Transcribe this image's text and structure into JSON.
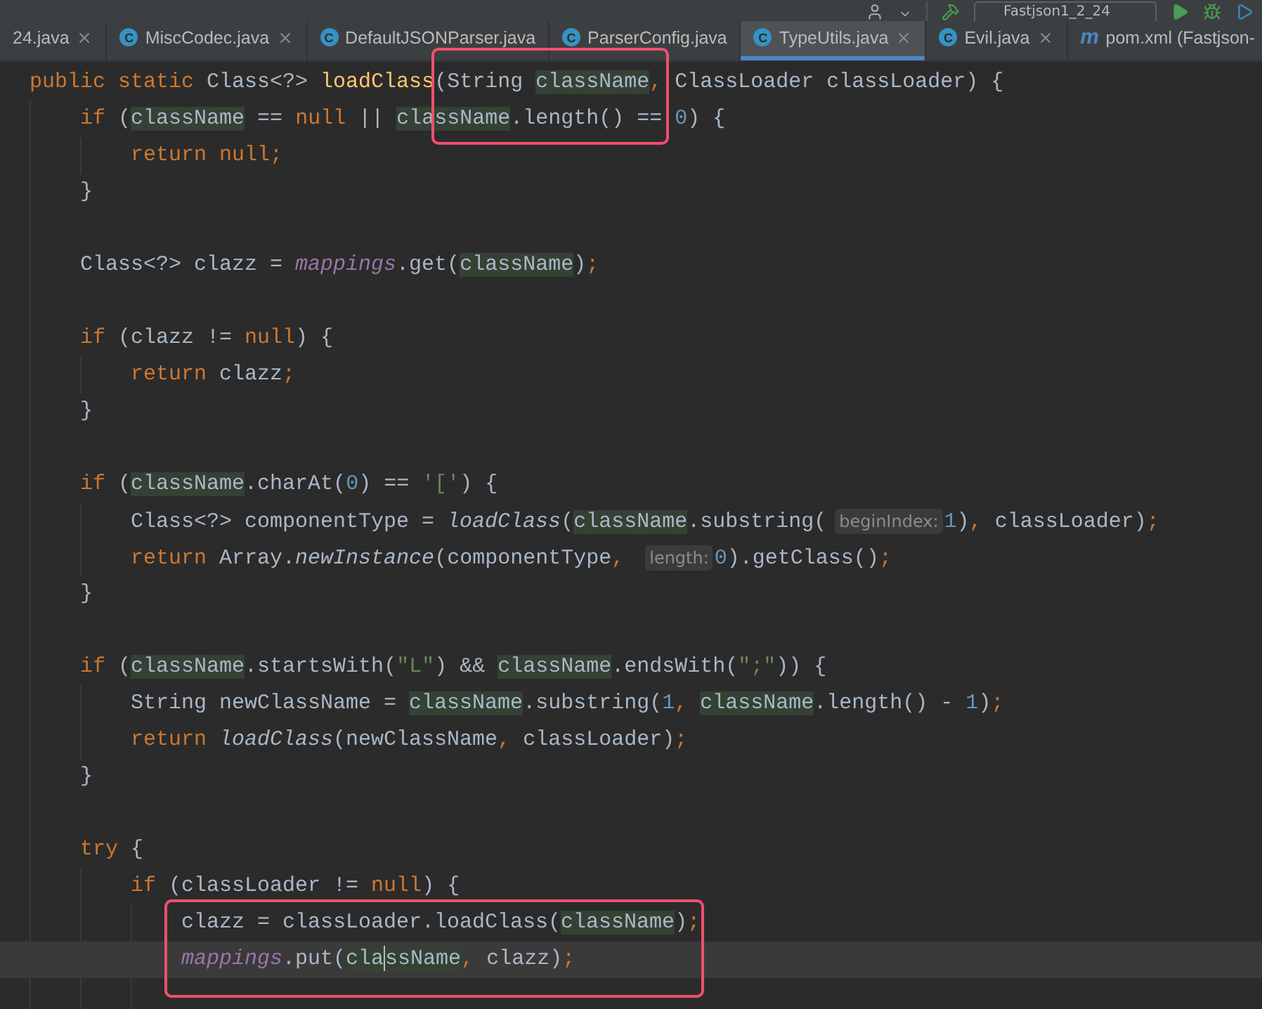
{
  "toolbar": {
    "run_config": "Fastjson1_2_24"
  },
  "tabs": [
    {
      "label": "24.java",
      "selected": false,
      "closable": true
    },
    {
      "label": "MiscCodec.java",
      "icon": "C",
      "selected": false,
      "closable": true
    },
    {
      "label": "DefaultJSONParser.java",
      "icon": "C",
      "selected": false,
      "closable": false
    },
    {
      "label": "ParserConfig.java",
      "icon": "C",
      "selected": false,
      "closable": false
    },
    {
      "label": "TypeUtils.java",
      "icon": "C",
      "selected": true,
      "closable": true
    },
    {
      "label": "Evil.java",
      "icon": "C",
      "selected": false,
      "closable": true
    },
    {
      "label": "pom.xml (Fastjson-",
      "icon": "m",
      "selected": false,
      "closable": false
    }
  ],
  "code": [
    {
      "tokens": [
        {
          "kind": "kw",
          "text": "public static "
        },
        {
          "kind": "txt",
          "text": "Class<?> "
        },
        {
          "kind": "decl",
          "text": "loadClass"
        },
        {
          "kind": "txt",
          "text": "(String "
        },
        {
          "kind": "hl",
          "text": "className"
        },
        {
          "kind": "p",
          "text": ", "
        },
        {
          "kind": "txt",
          "text": "ClassLoader classLoader) {"
        }
      ],
      "children": [
        {
          "current": false,
          "tokens": [
            {
              "kind": "kw",
              "text": "if "
            },
            {
              "kind": "txt",
              "text": "("
            },
            {
              "kind": "hl",
              "text": "className"
            },
            {
              "kind": "txt",
              "text": " == "
            },
            {
              "kind": "kw",
              "text": "null"
            },
            {
              "kind": "txt",
              "text": " || "
            },
            {
              "kind": "hl",
              "text": "className"
            },
            {
              "kind": "txt",
              "text": ".length() == "
            },
            {
              "kind": "num",
              "text": "0"
            },
            {
              "kind": "txt",
              "text": ") {"
            }
          ],
          "children": [
            {
              "current": false,
              "tokens": [
                {
                  "kind": "kw",
                  "text": "return null"
                },
                {
                  "kind": "p",
                  "text": ";"
                }
              ]
            }
          ]
        },
        {
          "current": false,
          "tokens": [
            {
              "kind": "txt",
              "text": "}"
            }
          ]
        },
        {
          "current": false
        },
        {
          "current": false,
          "tokens": [
            {
              "kind": "txt",
              "text": "Class<?> clazz = "
            },
            {
              "kind": "field",
              "text": "mappings"
            },
            {
              "kind": "txt",
              "text": ".get("
            },
            {
              "kind": "hl",
              "text": "className"
            },
            {
              "kind": "txt",
              "text": ")"
            },
            {
              "kind": "p",
              "text": ";"
            }
          ]
        },
        {
          "current": false
        },
        {
          "current": false,
          "tokens": [
            {
              "kind": "kw",
              "text": "if "
            },
            {
              "kind": "txt",
              "text": "(clazz != "
            },
            {
              "kind": "kw",
              "text": "null"
            },
            {
              "kind": "txt",
              "text": ") {"
            }
          ],
          "children": [
            {
              "current": false,
              "tokens": [
                {
                  "kind": "kw",
                  "text": "return "
                },
                {
                  "kind": "txt",
                  "text": "clazz"
                },
                {
                  "kind": "p",
                  "text": ";"
                }
              ]
            }
          ]
        },
        {
          "current": false,
          "tokens": [
            {
              "kind": "txt",
              "text": "}"
            }
          ]
        },
        {
          "current": false
        },
        {
          "current": false,
          "tokens": [
            {
              "kind": "kw",
              "text": "if "
            },
            {
              "kind": "txt",
              "text": "("
            },
            {
              "kind": "hl",
              "text": "className"
            },
            {
              "kind": "txt",
              "text": ".charAt("
            },
            {
              "kind": "num",
              "text": "0"
            },
            {
              "kind": "txt",
              "text": ") == "
            },
            {
              "kind": "str",
              "text": "'['"
            },
            {
              "kind": "txt",
              "text": ") {"
            }
          ],
          "children": [
            {
              "current": false,
              "tokens": [
                {
                  "kind": "txt",
                  "text": "Class<?> componentType = "
                },
                {
                  "kind": "static",
                  "text": "loadClass"
                },
                {
                  "kind": "txt",
                  "text": "("
                },
                {
                  "kind": "hl",
                  "text": "className"
                },
                {
                  "kind": "txt",
                  "text": ".substring("
                },
                {
                  "kind": "hint",
                  "text": "beginIndex:"
                },
                {
                  "kind": "num",
                  "text": "1"
                },
                {
                  "kind": "txt",
                  "text": ")"
                },
                {
                  "kind": "p",
                  "text": ", "
                },
                {
                  "kind": "txt",
                  "text": "classLoader)"
                },
                {
                  "kind": "p",
                  "text": ";"
                }
              ]
            },
            {
              "current": false,
              "tokens": [
                {
                  "kind": "kw",
                  "text": "return "
                },
                {
                  "kind": "txt",
                  "text": "Array."
                },
                {
                  "kind": "static",
                  "text": "newInstance"
                },
                {
                  "kind": "txt",
                  "text": "(componentType"
                },
                {
                  "kind": "p",
                  "text": ", "
                },
                {
                  "kind": "hint",
                  "text": "length:"
                },
                {
                  "kind": "num",
                  "text": "0"
                },
                {
                  "kind": "txt",
                  "text": ").getClass()"
                },
                {
                  "kind": "p",
                  "text": ";"
                }
              ]
            }
          ]
        },
        {
          "current": false,
          "tokens": [
            {
              "kind": "txt",
              "text": "}"
            }
          ]
        },
        {
          "current": false
        },
        {
          "current": false,
          "tokens": [
            {
              "kind": "kw",
              "text": "if "
            },
            {
              "kind": "txt",
              "text": "("
            },
            {
              "kind": "hl",
              "text": "className"
            },
            {
              "kind": "txt",
              "text": ".startsWith("
            },
            {
              "kind": "str",
              "text": "\"L\""
            },
            {
              "kind": "txt",
              "text": ") && "
            },
            {
              "kind": "hl",
              "text": "className"
            },
            {
              "kind": "txt",
              "text": ".endsWith("
            },
            {
              "kind": "str",
              "text": "\";\""
            },
            {
              "kind": "txt",
              "text": ")) {"
            }
          ],
          "children": [
            {
              "current": false,
              "tokens": [
                {
                  "kind": "txt",
                  "text": "String newClassName = "
                },
                {
                  "kind": "hl",
                  "text": "className"
                },
                {
                  "kind": "txt",
                  "text": ".substring("
                },
                {
                  "kind": "num",
                  "text": "1"
                },
                {
                  "kind": "p",
                  "text": ", "
                },
                {
                  "kind": "hl",
                  "text": "className"
                },
                {
                  "kind": "txt",
                  "text": ".length() - "
                },
                {
                  "kind": "num",
                  "text": "1"
                },
                {
                  "kind": "txt",
                  "text": ")"
                },
                {
                  "kind": "p",
                  "text": ";"
                }
              ]
            },
            {
              "current": false,
              "tokens": [
                {
                  "kind": "kw",
                  "text": "return "
                },
                {
                  "kind": "static",
                  "text": "loadClass"
                },
                {
                  "kind": "txt",
                  "text": "(newClassName"
                },
                {
                  "kind": "p",
                  "text": ", "
                },
                {
                  "kind": "txt",
                  "text": "classLoader)"
                },
                {
                  "kind": "p",
                  "text": ";"
                }
              ]
            }
          ]
        },
        {
          "current": false,
          "tokens": [
            {
              "kind": "txt",
              "text": "}"
            }
          ]
        },
        {
          "current": false
        },
        {
          "current": false,
          "tokens": [
            {
              "kind": "kw",
              "text": "try "
            },
            {
              "kind": "txt",
              "text": "{"
            }
          ],
          "children": [
            {
              "current": false,
              "tokens": [
                {
                  "kind": "kw",
                  "text": "if "
                },
                {
                  "kind": "txt",
                  "text": "(classLoader != "
                },
                {
                  "kind": "kw",
                  "text": "null"
                },
                {
                  "kind": "txt",
                  "text": ") {"
                }
              ],
              "children": [
                {
                  "current": false,
                  "tokens": [
                    {
                      "kind": "txt",
                      "text": "clazz = classLoader.loadClass("
                    },
                    {
                      "kind": "hl",
                      "text": "className"
                    },
                    {
                      "kind": "txt",
                      "text": ")"
                    },
                    {
                      "kind": "p",
                      "text": ";"
                    }
                  ]
                },
                {
                  "current": true,
                  "tokens": [
                    {
                      "kind": "field",
                      "text": "mappings"
                    },
                    {
                      "kind": "txt",
                      "text": ".put("
                    },
                    {
                      "kind": "hl",
                      "text": "cla"
                    },
                    {
                      "kind": "caret"
                    },
                    {
                      "kind": "hl",
                      "text": "ssName"
                    },
                    {
                      "kind": "p",
                      "text": ", "
                    },
                    {
                      "kind": "txt",
                      "text": "clazz)"
                    },
                    {
                      "kind": "p",
                      "text": ";"
                    }
                  ]
                },
                {
                  "current": false
                }
              ]
            }
          ]
        }
      ]
    }
  ],
  "annotations": [
    {
      "kind": "frame"
    },
    {
      "kind": "frame"
    }
  ]
}
